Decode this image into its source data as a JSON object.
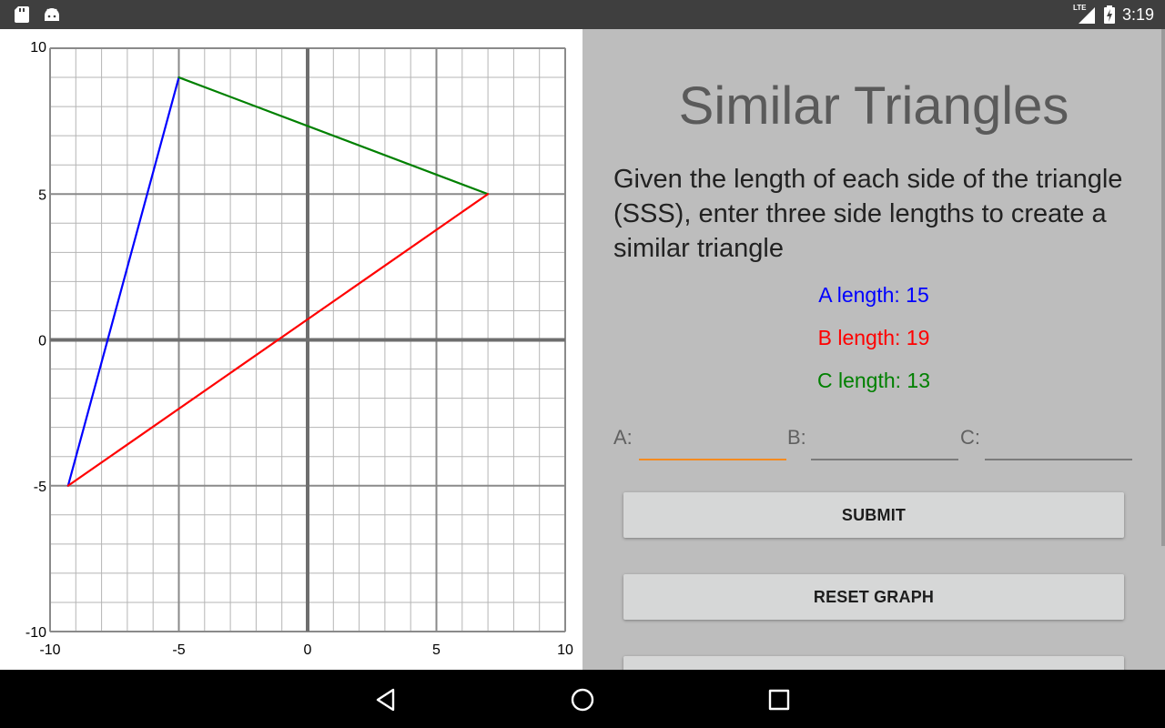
{
  "status_bar": {
    "time": "3:19",
    "network": "LTE",
    "icons": [
      "sd-card-icon",
      "android-icon",
      "signal-icon",
      "battery-charging-icon"
    ]
  },
  "graph": {
    "x_ticks": [
      "-10",
      "-5",
      "0",
      "5",
      "10"
    ],
    "y_ticks": [
      "10",
      "5",
      "0",
      "-5",
      "-10"
    ],
    "xlim": [
      -10,
      10
    ],
    "ylim": [
      -10,
      10
    ],
    "grid_step": 1,
    "vertices": {
      "p1": [
        -9.3,
        -5
      ],
      "p2": [
        -5,
        9
      ],
      "p3": [
        7,
        5
      ]
    },
    "sides": [
      {
        "from": "p1",
        "to": "p2",
        "color": "#0000ff"
      },
      {
        "from": "p2",
        "to": "p3",
        "color": "#008000"
      },
      {
        "from": "p1",
        "to": "p3",
        "color": "#ff0000"
      }
    ]
  },
  "panel": {
    "title": "Similar Triangles",
    "description": "Given the length of each side of the triangle (SSS), enter three side lengths to create a similar triangle",
    "a_length": "A length: 15",
    "b_length": "B length: 19",
    "c_length": "C length: 13",
    "a_label": "A:",
    "b_label": "B:",
    "c_label": "C:",
    "a_value": "",
    "b_value": "",
    "c_value": "",
    "submit_label": "SUBMIT",
    "reset_label": "RESET GRAPH",
    "colors": {
      "a": "#0000ff",
      "b": "#ff0000",
      "c": "#008000",
      "focus": "#f58b1f"
    }
  },
  "nav_bar": {
    "icons": [
      "back-icon",
      "home-icon",
      "recents-icon"
    ]
  }
}
